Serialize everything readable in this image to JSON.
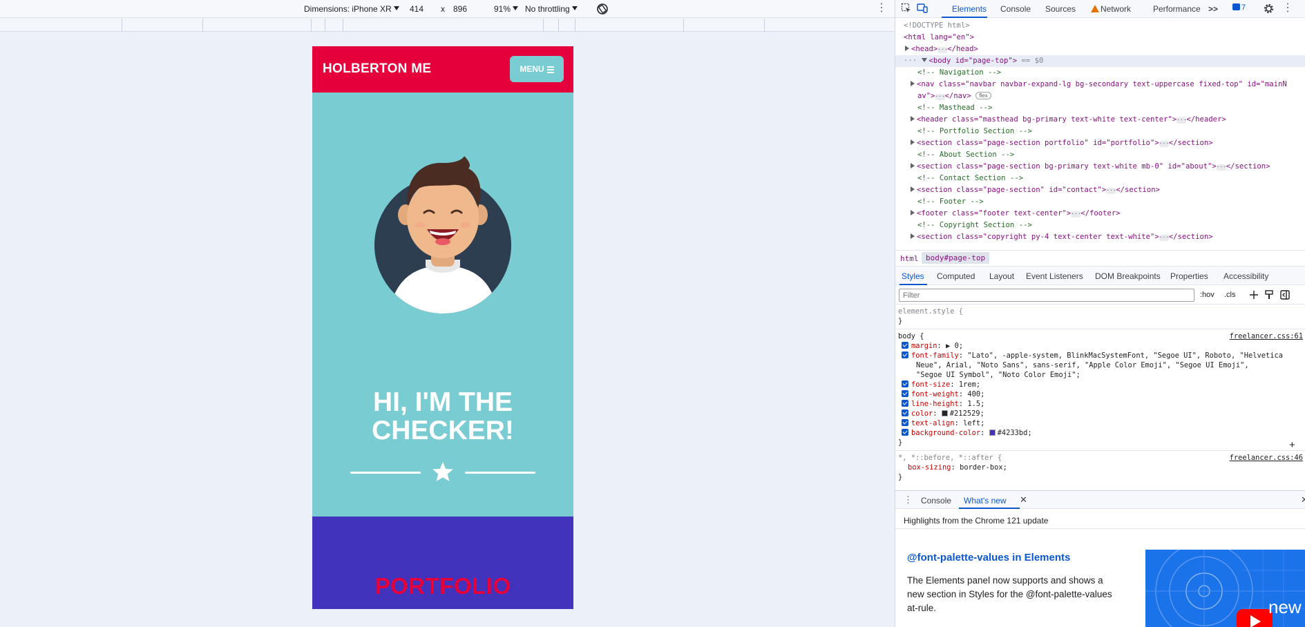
{
  "device_toolbar": {
    "dimensions_label": "Dimensions: iPhone XR",
    "width": "414",
    "times": "x",
    "height": "896",
    "zoom": "91%",
    "throttling": "No throttling"
  },
  "site": {
    "brand": "HOLBERTON ME",
    "menu_label": "MENU",
    "hero_line1": "HI, I'M THE",
    "hero_line2": "CHECKER!",
    "portfolio_heading": "PORTFOLIO",
    "colors": {
      "nav": "#e5003b",
      "masthead": "#78ccd2",
      "body": "#4233bd",
      "portfolio_heading": "#e5003b"
    }
  },
  "devtools": {
    "tabs": [
      "Elements",
      "Console",
      "Sources",
      "Network",
      "Performance"
    ],
    "overflow_tabs": ">>",
    "issues_count": "7",
    "dom": {
      "doctype": "<!DOCTYPE html>",
      "html_open": "<html lang=\"en\">",
      "head": "<head>",
      "head_close": "</head>",
      "body_tag": "<body id=\"page-top\">",
      "body_eq": "== $0",
      "c_nav": "<!-- Navigation -->",
      "nav_line1": "<nav class=\"navbar navbar-expand-lg bg-secondary text-uppercase fixed-top\" id=\"mainN",
      "nav_line2a": "av\">",
      "nav_line2b": "</nav>",
      "flex": "flex",
      "c_masthead": "<!-- Masthead -->",
      "header": "<header class=\"masthead bg-primary text-white text-center\">",
      "header_close": "</header>",
      "c_portfolio": "<!-- Portfolio Section -->",
      "section_portfolio": "<section class=\"page-section portfolio\" id=\"portfolio\">",
      "section_close": "</section>",
      "c_about": "<!-- About Section -->",
      "section_about": "<section class=\"page-section bg-primary text-white mb-0\" id=\"about\">",
      "c_contact": "<!-- Contact Section -->",
      "section_contact": "<section class=\"page-section\" id=\"contact\">",
      "c_footer": "<!-- Footer -->",
      "footer": "<footer class=\"footer text-center\">",
      "footer_close": "</footer>",
      "c_copyright": "<!-- Copyright Section -->",
      "section_copyright": "<section class=\"copyright py-4 text-center text-white\">"
    },
    "breadcrumb": [
      "html",
      "body#page-top"
    ],
    "subtabs": [
      "Styles",
      "Computed",
      "Layout",
      "Event Listeners",
      "DOM Breakpoints",
      "Properties",
      "Accessibility"
    ],
    "filter_placeholder": "Filter",
    "filter_tools": [
      ":hov",
      ".cls"
    ],
    "styles": {
      "element_style": "element.style {",
      "close_brace": "}",
      "body_selector": "body {",
      "body_source": "freelancer.css:61",
      "props": [
        {
          "name": "margin",
          "value": "▶ 0;"
        },
        {
          "name": "font-family",
          "value": "\"Lato\", -apple-system, BlinkMacSystemFont, \"Segoe UI\", Roboto, \"Helvetica"
        },
        {
          "name": "font-size",
          "value": "1rem;"
        },
        {
          "name": "font-weight",
          "value": "400;"
        },
        {
          "name": "line-height",
          "value": "1.5;"
        },
        {
          "name": "color",
          "value": "#212529;"
        },
        {
          "name": "text-align",
          "value": "left;"
        },
        {
          "name": "background-color",
          "value": "#4233bd;"
        }
      ],
      "font_family_cont1": "Neue\", Arial, \"Noto Sans\", sans-serif, \"Apple Color Emoji\", \"Segoe UI Emoji\",",
      "font_family_cont2": "\"Segoe UI Symbol\", \"Noto Color Emoji\";",
      "universal_selector": "*, *::before, *::after {",
      "universal_source": "freelancer.css:46",
      "box_sizing_name": "box-sizing",
      "box_sizing_value": "border-box;",
      "color_swatch": "#212529",
      "bg_swatch": "#4233bd"
    },
    "drawer": {
      "tabs": [
        "Console",
        "What's new"
      ],
      "subtitle": "Highlights from the Chrome 121 update",
      "news_title": "@font-palette-values in Elements",
      "news_body": "The Elements panel now supports and shows a new section in Styles for the @font-palette-values at-rule.",
      "thumb_text": "new"
    }
  }
}
